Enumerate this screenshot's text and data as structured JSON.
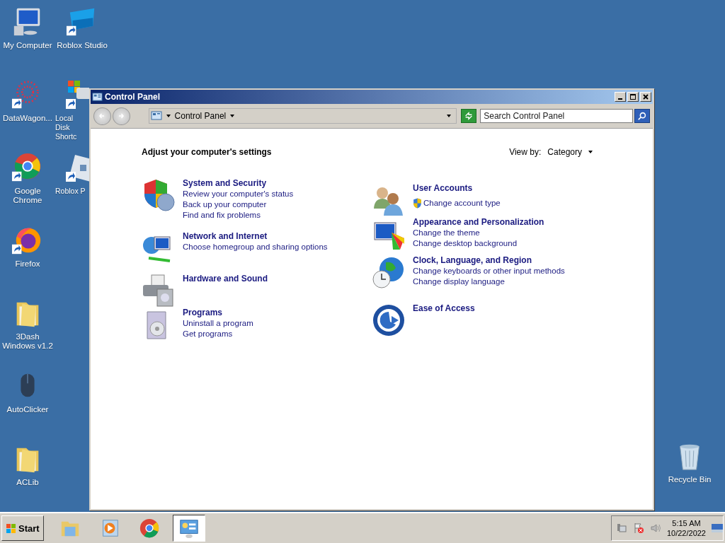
{
  "desktop": {
    "left_column": [
      {
        "label": "My Computer",
        "kind": "computer",
        "shortcut": false
      },
      {
        "label": "DataWagon...",
        "kind": "dots",
        "shortcut": true
      },
      {
        "label": "Google Chrome",
        "kind": "chrome",
        "shortcut": true
      },
      {
        "label": "Firefox",
        "kind": "firefox",
        "shortcut": true
      },
      {
        "label": "3Dash Windows v1.2",
        "kind": "folder",
        "shortcut": false
      },
      {
        "label": "AutoClicker",
        "kind": "mouse",
        "shortcut": false
      },
      {
        "label": "ACLib",
        "kind": "folder",
        "shortcut": false
      }
    ],
    "right_column": [
      {
        "label": "Roblox Studio",
        "kind": "studio",
        "shortcut": true
      },
      {
        "label": "Local Disk Shortc",
        "kind": "disk",
        "shortcut": true
      },
      {
        "label": "Roblox P",
        "kind": "player",
        "shortcut": true
      }
    ],
    "corner": [
      {
        "label": "Recycle Bin",
        "kind": "bin",
        "shortcut": false
      }
    ]
  },
  "window": {
    "title": "Control Panel",
    "address": "Control Panel",
    "search": {
      "placeholder": "Search Control Panel"
    },
    "heading": "Adjust your computer's settings",
    "view_by": {
      "label": "View by:",
      "value": "Category"
    },
    "left_categories": [
      {
        "kind": "security",
        "title": "System and Security",
        "links": [
          {
            "text": "Review your computer's status",
            "shield": false
          },
          {
            "text": "Back up your computer",
            "shield": false
          },
          {
            "text": "Find and fix problems",
            "shield": false
          }
        ]
      },
      {
        "kind": "network",
        "title": "Network and Internet",
        "links": [
          {
            "text": "Choose homegroup and sharing options",
            "shield": false
          }
        ]
      },
      {
        "kind": "hardware",
        "title": "Hardware and Sound"
      },
      {
        "kind": "programs",
        "title": "Programs",
        "links": [
          {
            "text": "Uninstall a program",
            "shield": false
          },
          {
            "text": "Get programs",
            "shield": false
          }
        ]
      }
    ],
    "right_categories": [
      {
        "kind": "users",
        "title": "User Accounts",
        "links": [
          {
            "text": "Change account type",
            "shield": true
          }
        ]
      },
      {
        "kind": "appearance",
        "title": "Appearance and Personalization",
        "links": [
          {
            "text": "Change the theme",
            "shield": false
          },
          {
            "text": "Change desktop background",
            "shield": false
          }
        ]
      },
      {
        "kind": "clock",
        "title": "Clock, Language, and Region",
        "links": [
          {
            "text": "Change keyboards or other input methods",
            "shield": false
          },
          {
            "text": "Change display language",
            "shield": false
          }
        ]
      },
      {
        "kind": "ease",
        "title": "Ease of Access"
      }
    ]
  },
  "taskbar": {
    "start": "Start",
    "apps": [
      {
        "kind": "explorer",
        "selected": false
      },
      {
        "kind": "media",
        "selected": false
      },
      {
        "kind": "chrome",
        "selected": false
      },
      {
        "kind": "control",
        "selected": true
      }
    ],
    "tray": [
      {
        "kind": "network"
      },
      {
        "kind": "flag"
      },
      {
        "kind": "volume"
      }
    ],
    "time": "5:15 AM",
    "date": "10/22/2022"
  }
}
